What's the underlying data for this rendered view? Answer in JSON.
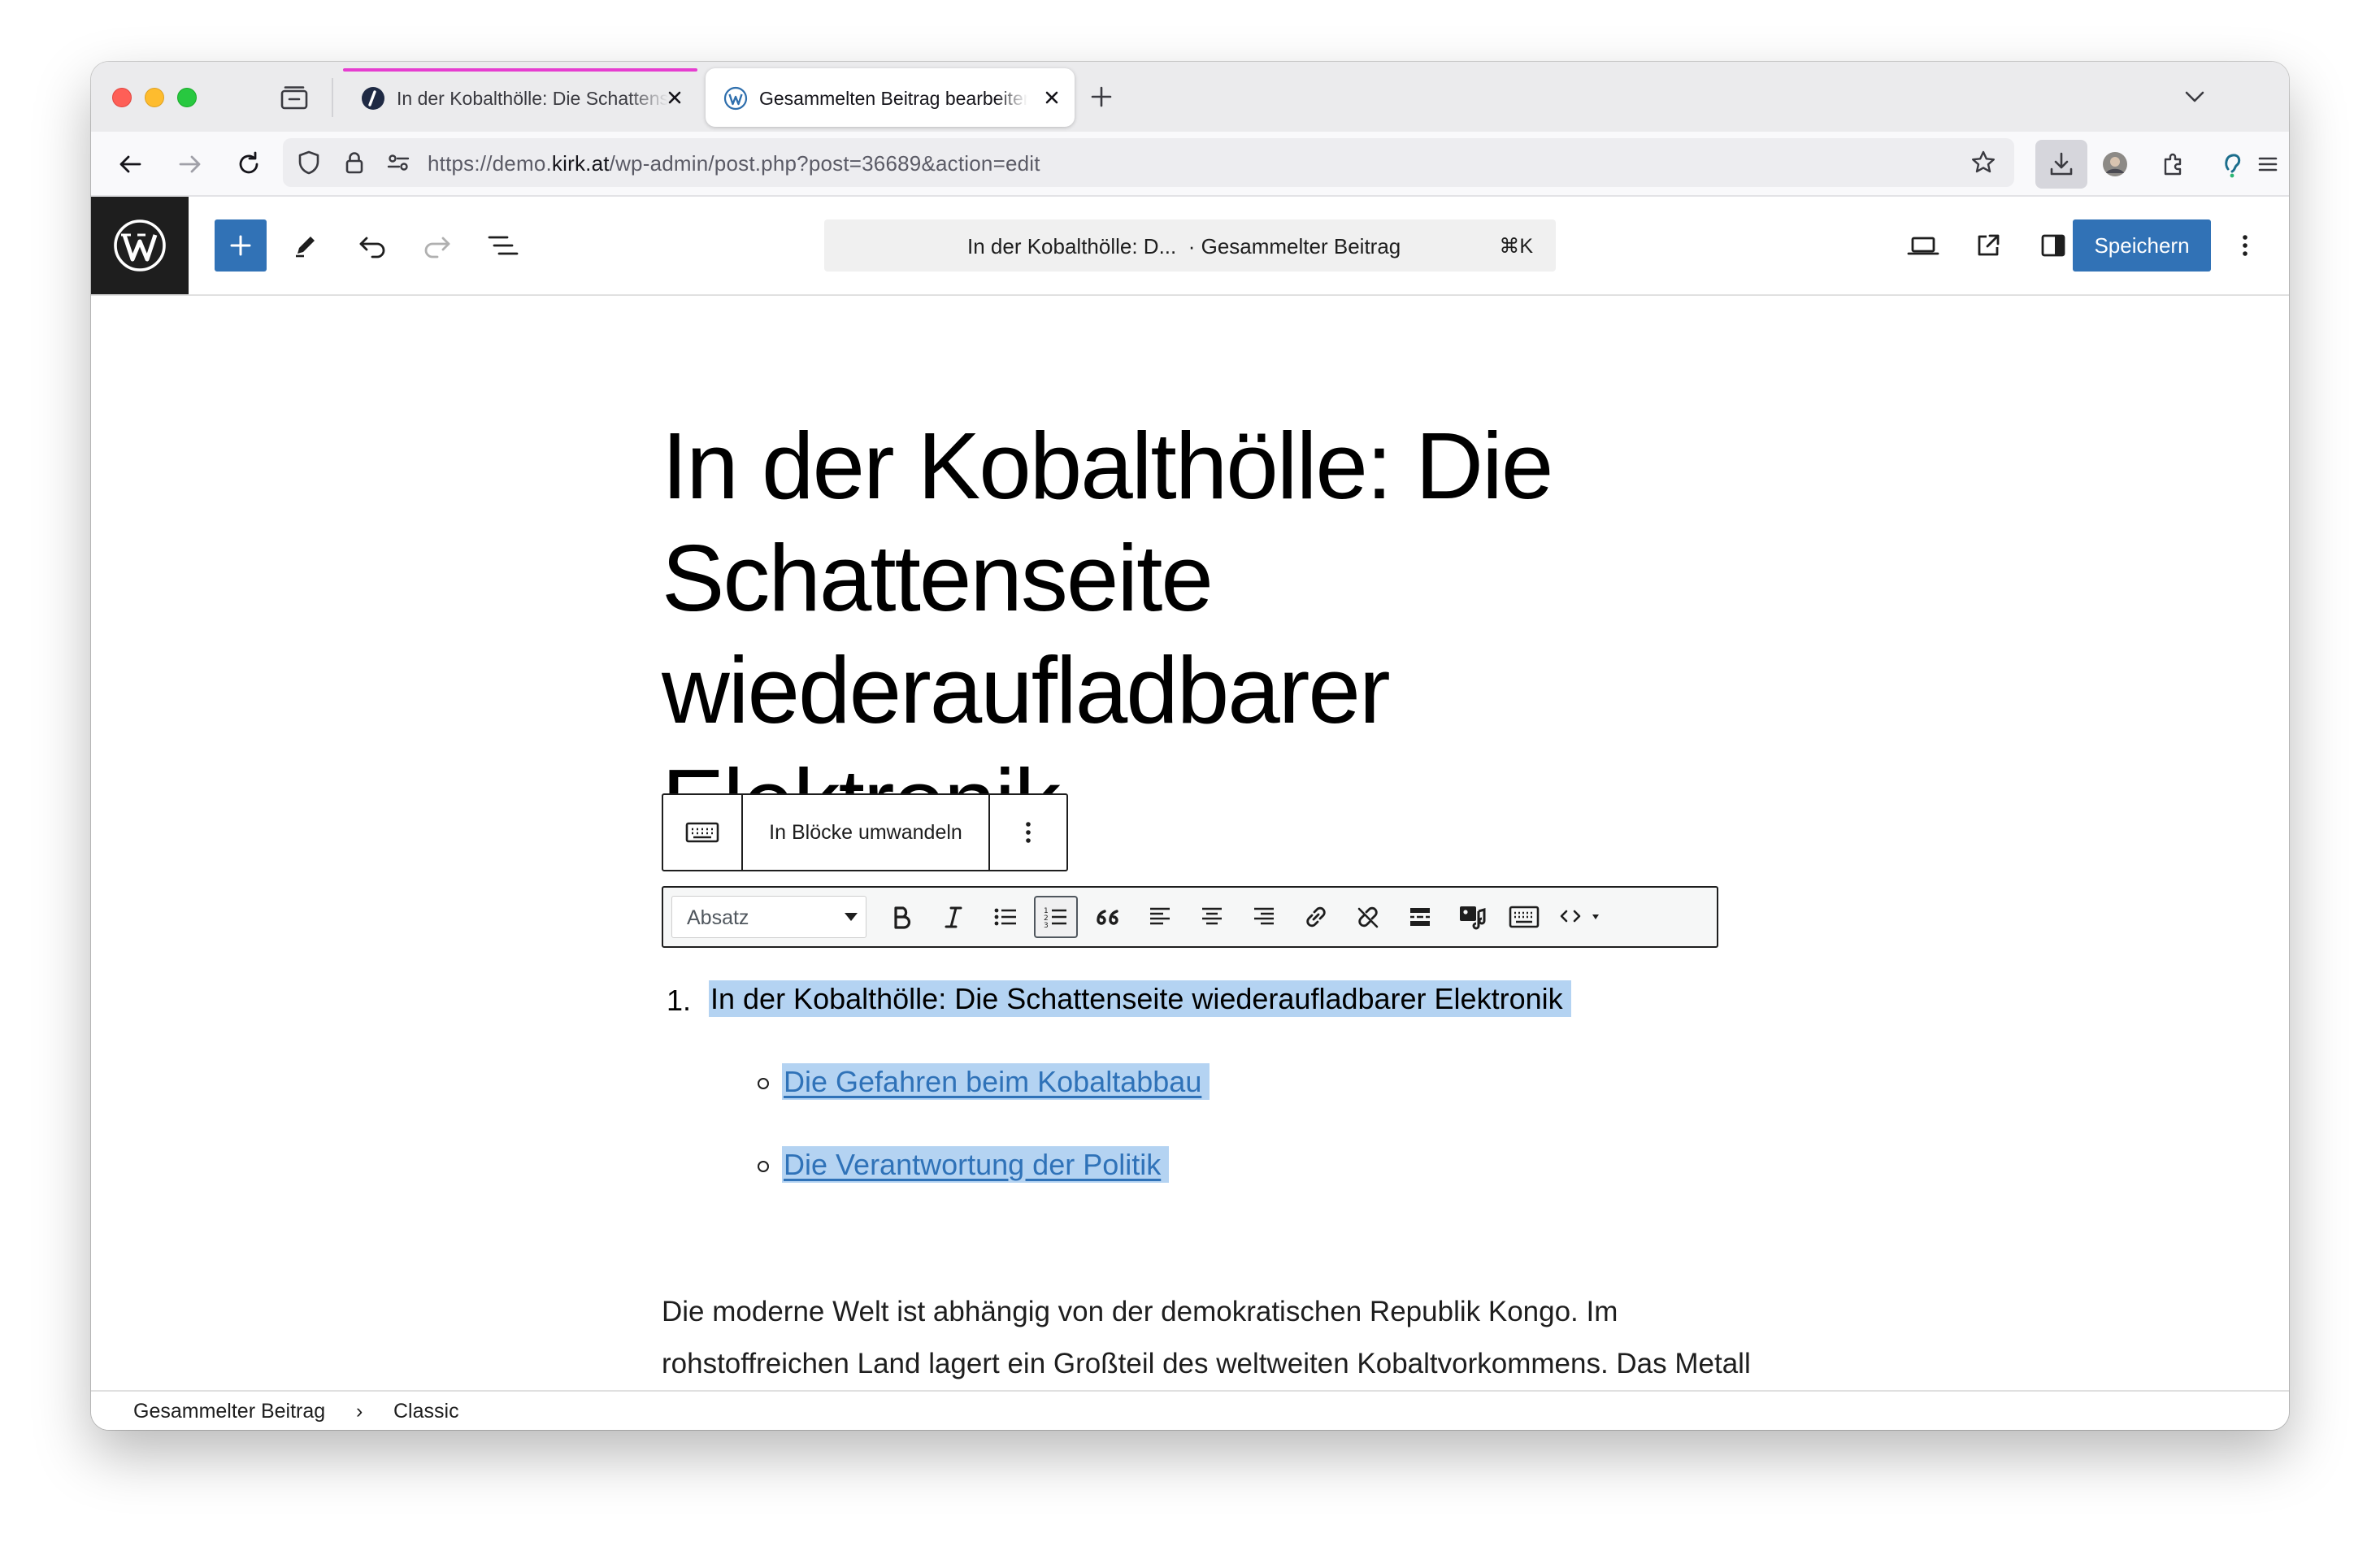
{
  "browser": {
    "tabs": [
      {
        "title": "In der Kobalthölle: Die Schattenseite",
        "icon": "site-favicon"
      },
      {
        "title": "Gesammelten Beitrag bearbeiten",
        "icon": "wordpress-favicon"
      }
    ],
    "url": {
      "prefix": "https://demo.",
      "host": "kirk.at",
      "path": "/wp-admin/post.php?post=36689&action=edit"
    }
  },
  "editor": {
    "document_title": "In der Kobalthölle: D...",
    "post_type": "· Gesammelter Beitrag",
    "shortcut": "⌘K",
    "save_label": "Speichern"
  },
  "post": {
    "title": "In der Kobalthölle: Die Schattenseite wiederaufladbarer Elektronik"
  },
  "block_toolbar": {
    "convert_label": "In Blöcke umwandeln"
  },
  "classic_toolbar": {
    "format_value": "Absatz",
    "tools": [
      "bold-icon",
      "italic-icon",
      "bullet-list-icon",
      "numbered-list-icon",
      "blockquote-icon",
      "align-left-icon",
      "align-center-icon",
      "align-right-icon",
      "link-icon",
      "unlink-icon",
      "read-more-icon",
      "add-media-icon",
      "keyboard-icon",
      "code-icon"
    ]
  },
  "content": {
    "ol_number": "1.",
    "ol_item": "In der Kobalthölle: Die Schattenseite wiederaufladbarer Elektronik",
    "sub_items": [
      "Die Gefahren beim Kobaltabbau",
      "Die Verantwortung der Politik"
    ],
    "paragraph": "Die moderne Welt ist abhängig von der demokratischen Republik Kongo. Im rohstoffreichen Land lagert ein Großteil des weltweiten Kobaltvorkommens. Das Metall steckt in den Akkus von Smartphones, Notebooks und E-Autos und doch"
  },
  "breadcrumb": {
    "items": [
      "Gesammelter Beitrag",
      "Classic"
    ],
    "separator": "›"
  },
  "colors": {
    "wp_blue": "#3172b6",
    "selection": "#b4d3f2",
    "link": "#2f72b8",
    "tab_accent": "#e63dd0"
  }
}
